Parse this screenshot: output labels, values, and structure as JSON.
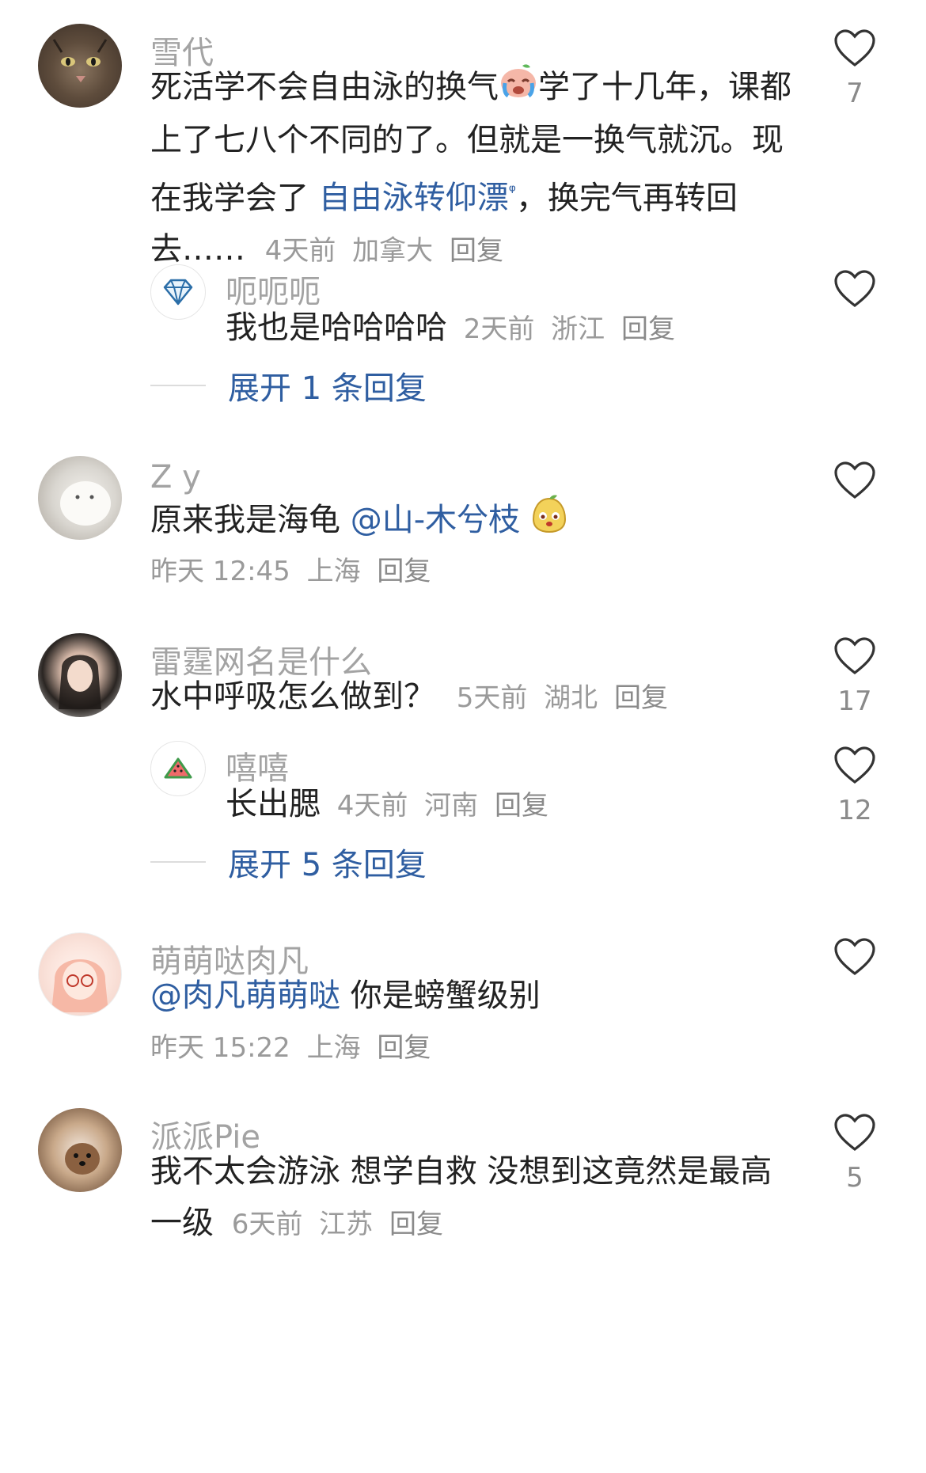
{
  "comments": [
    {
      "username": "雪代",
      "text_parts": [
        "死活学不会自由泳的换气",
        "学了十几年，课都上了七八个不同的了。但就是一换气就沉。现在我学会了 ",
        "自由泳转仰漂",
        "，换完气再转回去……"
      ],
      "time": "4天前",
      "location": "加拿大",
      "reply_label": "回复",
      "likes": "7",
      "emoji_icon": "crying-face-emoji-icon",
      "replies": [
        {
          "username": "呃呃呃",
          "text": "我也是哈哈哈哈",
          "time": "2天前",
          "location": "浙江",
          "reply_label": "回复",
          "likes": "",
          "avatar_icon": "diamond-icon"
        }
      ],
      "expand_label": "展开 1 条回复"
    },
    {
      "username": "Z          y",
      "text_parts": [
        "原来我是海龟 ",
        "@山-木兮枝"
      ],
      "time": "昨天 12:45",
      "location": "上海",
      "reply_label": "回复",
      "likes": "",
      "emoji_icon": "smiling-pear-emoji-icon"
    },
    {
      "username": "雷霆网名是什么",
      "text": "水中呼吸怎么做到？",
      "time": "5天前",
      "location": "湖北",
      "reply_label": "回复",
      "likes": "17",
      "replies": [
        {
          "username": "嘻嘻",
          "text": "长出腮",
          "time": "4天前",
          "location": "河南",
          "reply_label": "回复",
          "likes": "12",
          "avatar_icon": "watermelon-icon"
        }
      ],
      "expand_label": "展开 5 条回复"
    },
    {
      "username": "萌萌哒肉凡",
      "text_parts": [
        "@肉凡萌萌哒",
        " 你是螃蟹级别"
      ],
      "time": "昨天 15:22",
      "location": "上海",
      "reply_label": "回复",
      "likes": ""
    },
    {
      "username": "派派Pie",
      "text": "我不太会游泳 想学自救 没想到这竟然是最高一级",
      "time": "6天前",
      "location": "江苏",
      "reply_label": "回复",
      "likes": "5"
    }
  ],
  "icons": {
    "like": "heart-outline-icon",
    "search_hint": "search-icon"
  },
  "colors": {
    "link_blue": "#2f5ea1",
    "meta_gray": "#9a9a9a",
    "username_gray": "#a3a3a3"
  }
}
